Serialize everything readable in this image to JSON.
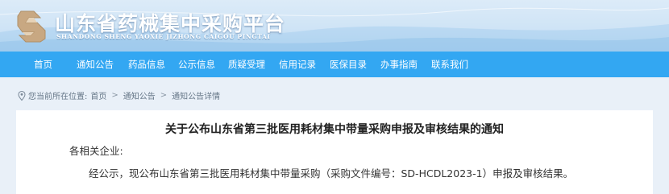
{
  "header": {
    "title": "山东省药械集中采购平台",
    "subtitle": "SHANDONG SHENG YAOXIE JIZHONG CAIGOU PINGTAI",
    "logo_icon": "ss-logo-icon",
    "colors": {
      "sky": "#cfe4f6",
      "logo": "#c8a882"
    }
  },
  "nav": {
    "background": "#33a7f2",
    "items": [
      {
        "label": "首页"
      },
      {
        "label": "通知公告"
      },
      {
        "label": "药品信息"
      },
      {
        "label": "公示信息"
      },
      {
        "label": "质疑受理"
      },
      {
        "label": "信用记录"
      },
      {
        "label": "医保目录"
      },
      {
        "label": "办事指南"
      },
      {
        "label": "联系我们"
      }
    ]
  },
  "breadcrumb": {
    "icon": "location-pin-icon",
    "prefix": "您当前所在位置:",
    "items": [
      "首页",
      "通知公告",
      "通知公告详情"
    ],
    "separator": ">"
  },
  "article": {
    "title": "关于公布山东省第三批医用耗材集中带量采购申报及审核结果的通知",
    "greeting": "各相关企业:",
    "paragraph": "经公示，现公布山东省第三批医用耗材集中带量采购（采购文件编号：SD-HCDL2023-1）申报及审核结果。"
  }
}
